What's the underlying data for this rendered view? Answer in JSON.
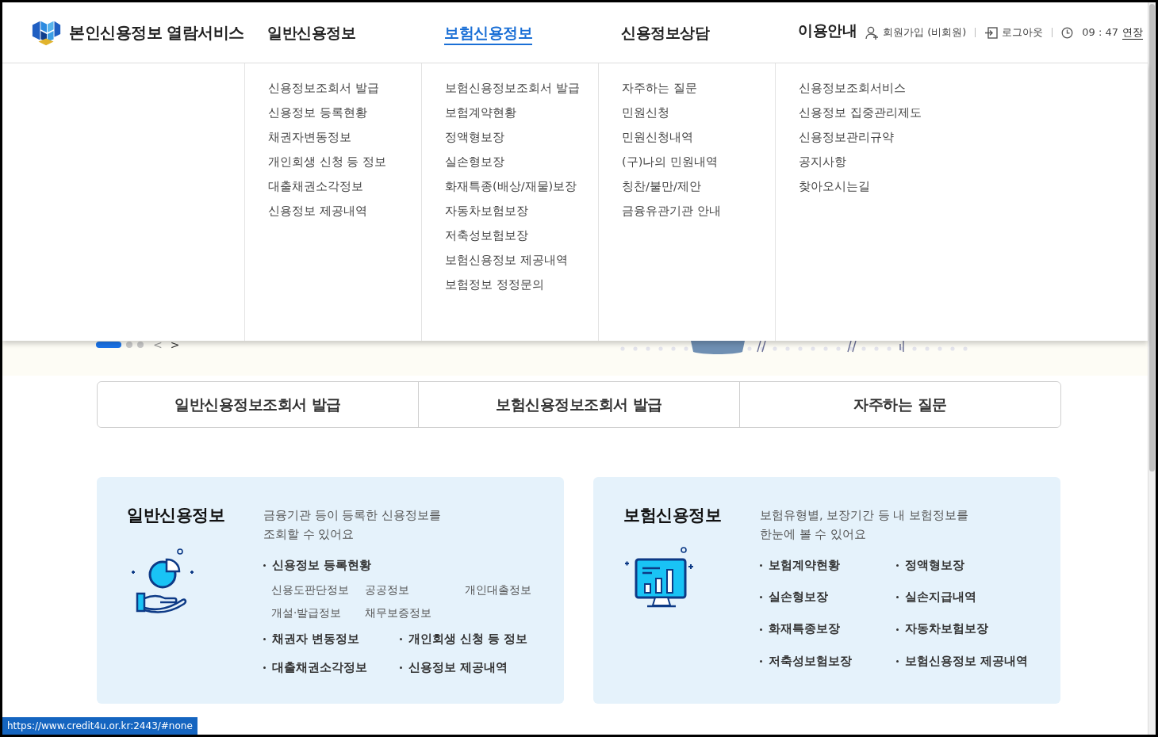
{
  "header": {
    "logo_text": "본인신용정보 열람서비스",
    "nav": [
      {
        "label": "일반신용정보",
        "selected": false
      },
      {
        "label": "보험신용정보",
        "selected": true
      },
      {
        "label": "신용정보상담",
        "selected": false
      },
      {
        "label": "이용안내",
        "selected": false
      }
    ],
    "utilities": [
      {
        "kind": "signup",
        "label": "회원가입 (비회원)"
      },
      {
        "kind": "logout",
        "label": "로그아웃"
      }
    ],
    "session": {
      "time": "09 : 47",
      "extend": "연장"
    }
  },
  "mega_menu": [
    {
      "items": [
        "신용정보조회서 발급",
        "신용정보 등록현황",
        "채권자변동정보",
        "개인회생 신청 등 정보",
        "대출채권소각정보",
        "신용정보 제공내역"
      ]
    },
    {
      "items": [
        "보험신용정보조회서 발급",
        "보험계약현황",
        "정액형보장",
        "실손형보장",
        "화재특종(배상/재물)보장",
        "자동차보험보장",
        "저축성보험보장",
        "보험신용정보 제공내역",
        "보험정보 정정문의"
      ]
    },
    {
      "items": [
        "자주하는 질문",
        "민원신청",
        "민원신청내역",
        "(구)나의 민원내역",
        "칭찬/불만/제안",
        "금융유관기관 안내"
      ]
    },
    {
      "items": [
        "신용정보조회서비스",
        "신용정보 집중관리제도",
        "신용정보관리규약",
        "공지사항",
        "찾아오시는길"
      ]
    }
  ],
  "hero": {
    "slides": [
      {
        "selected": true
      },
      {
        "selected": false
      },
      {
        "selected": false
      }
    ],
    "prev": "<",
    "next": ">"
  },
  "quick_links": [
    "일반신용정보조회서 발급",
    "보험신용정보조회서 발급",
    "자주하는 질문"
  ],
  "cards": [
    {
      "kind": "hand-chart",
      "title": "일반신용정보",
      "description": [
        "금융기관 등이 등록한 신용정보를",
        "조회할 수 있어요"
      ],
      "featured": {
        "label": "신용정보 등록현황",
        "sub_items": [
          "신용도판단정보",
          "공공정보",
          "개인대출정보",
          "개설·발급정보",
          "채무보증정보"
        ]
      },
      "items": [
        "채권자 변동정보",
        "개인회생 신청 등 정보",
        "대출채권소각정보",
        "신용정보 제공내역"
      ]
    },
    {
      "kind": "monitor-chart",
      "title": "보험신용정보",
      "description": [
        "보험유형별, 보장기간 등 내 보험정보를",
        "한눈에 볼 수 있어요"
      ],
      "items": [
        "보험계약현황",
        "정액형보장",
        "실손형보장",
        "실손지급내역",
        "화재특종보장",
        "자동차보험보장",
        "저축성보험보장",
        "보험신용정보 제공내역"
      ]
    }
  ],
  "status_bar": {
    "url": "https://www.credit4u.or.kr:2443/#none"
  }
}
